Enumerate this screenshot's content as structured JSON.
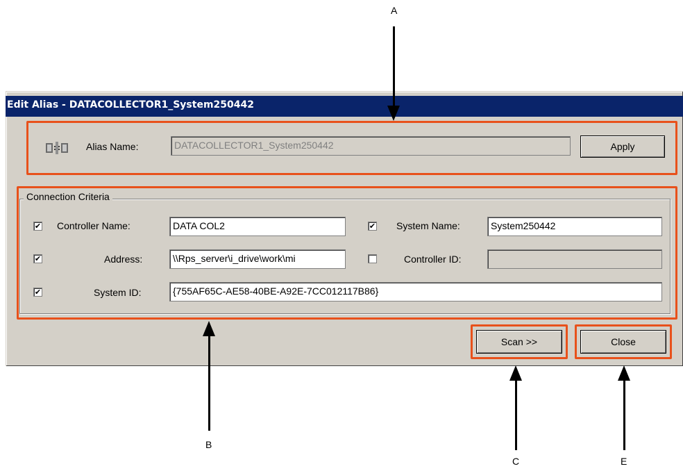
{
  "dialog": {
    "title": "Edit Alias - DATACOLLECTOR1_System250442"
  },
  "alias": {
    "label": "Alias Name:",
    "value": "DATACOLLECTOR1_System250442",
    "apply_label": "Apply",
    "icon": "alias-icon"
  },
  "criteria": {
    "group_label": "Connection Criteria",
    "controller_name": {
      "label": "Controller Name:",
      "value": "DATA COL2",
      "checked": "✔"
    },
    "system_name": {
      "label": "System Name:",
      "value": "System250442",
      "checked": "✔"
    },
    "address": {
      "label": "Address:",
      "value": "\\\\Rps_server\\i_drive\\work\\mi",
      "checked": "✔"
    },
    "controller_id": {
      "label": "Controller ID:",
      "value": "",
      "checked": ""
    },
    "system_id": {
      "label": "System ID:",
      "value": "{755AF65C-AE58-40BE-A92E-7CC012117B86}",
      "checked": "✔"
    }
  },
  "buttons": {
    "scan_label": "Scan >>",
    "close_label": "Close"
  },
  "callouts": {
    "a": "A",
    "b": "B",
    "c": "C",
    "e": "E"
  },
  "colors": {
    "titlebar": "#0a246a",
    "highlight": "#e8511b",
    "dialog_bg": "#d4d0c8"
  }
}
